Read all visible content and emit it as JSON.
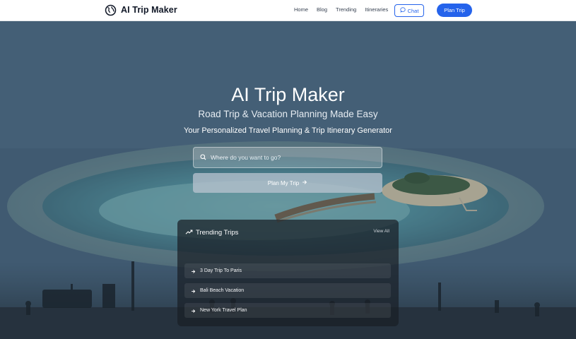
{
  "header": {
    "brand": "AI Trip Maker",
    "nav": [
      {
        "label": "Home"
      },
      {
        "label": "Blog"
      },
      {
        "label": "Trending"
      },
      {
        "label": "Itineraries"
      }
    ],
    "chat_label": "Chat",
    "plan_label": "Plan Trip"
  },
  "hero": {
    "title": "AI Trip Maker",
    "subtitle": "Road Trip & Vacation Planning Made Easy",
    "tagline": "Your Personalized Travel Planning & Trip Itinerary Generator",
    "search_placeholder": "Where do you want to go?",
    "submit_label": "Plan My Trip"
  },
  "trending": {
    "title": "Trending Trips",
    "view_all": "View All",
    "items": [
      {
        "label": "3 Day Trip To Paris"
      },
      {
        "label": "Bali Beach Vacation"
      },
      {
        "label": "New York Travel Plan"
      }
    ]
  },
  "colors": {
    "accent": "#2563eb",
    "header_bg": "#ffffff",
    "panel_bg": "#1e252e"
  },
  "icons": [
    "globe-icon",
    "chat-bubble-icon",
    "search-icon",
    "arrow-right-icon",
    "trending-up-icon"
  ]
}
